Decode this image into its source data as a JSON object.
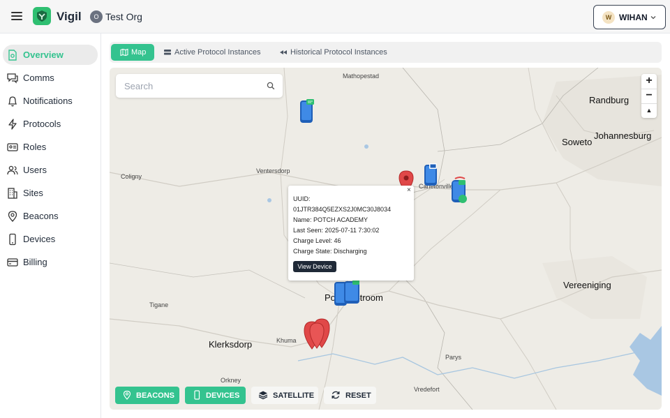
{
  "app": {
    "brand": "Vigil",
    "org_initial": "O",
    "org_name": "Test Org"
  },
  "user": {
    "initial": "W",
    "name": "WIHAN"
  },
  "sidebar": {
    "items": [
      {
        "label": "Overview",
        "icon": "overview-icon",
        "active": true
      },
      {
        "label": "Comms",
        "icon": "chat-icon"
      },
      {
        "label": "Notifications",
        "icon": "bell-icon"
      },
      {
        "label": "Protocols",
        "icon": "lightning-icon"
      },
      {
        "label": "Roles",
        "icon": "id-card-icon"
      },
      {
        "label": "Users",
        "icon": "users-icon"
      },
      {
        "label": "Sites",
        "icon": "building-icon"
      },
      {
        "label": "Beacons",
        "icon": "location-pin-icon"
      },
      {
        "label": "Devices",
        "icon": "phone-icon"
      },
      {
        "label": "Billing",
        "icon": "credit-card-icon"
      }
    ]
  },
  "tabs": [
    {
      "label": "Map",
      "active": true
    },
    {
      "label": "Active Protocol Instances"
    },
    {
      "label": "Historical Protocol Instances"
    }
  ],
  "map": {
    "search_placeholder": "Search",
    "zoom_in": "+",
    "zoom_out": "−",
    "reset_north": "▲",
    "places": [
      "Mathopestad",
      "Randburg",
      "Johannesburg",
      "Soweto",
      "Coligny",
      "Ventersdorp",
      "Carletonville",
      "Vereeniging",
      "Tigane",
      "Potchefstroom",
      "Klerksdorp",
      "Khuma",
      "Parys",
      "Orkney",
      "Vredefort"
    ],
    "popup": {
      "close": "×",
      "uuid_label": "UUID:",
      "uuid": "01JTR384Q5EZXS2J0MC30J8034",
      "name": "Name: POTCH ACADEMY",
      "last_seen": "Last Seen: 2025-07-11 7:30:02",
      "charge_level": "Charge Level: 46",
      "charge_state": "Charge State: Discharging",
      "view_button": "View Device"
    },
    "buttons": {
      "beacons": "BEACONS",
      "devices": "DEVICES",
      "satellite": "SATELLITE",
      "reset": "RESET"
    }
  },
  "colors": {
    "accent": "#34c38f",
    "marker_red": "#e04848",
    "marker_blue": "#2f7fd8"
  }
}
